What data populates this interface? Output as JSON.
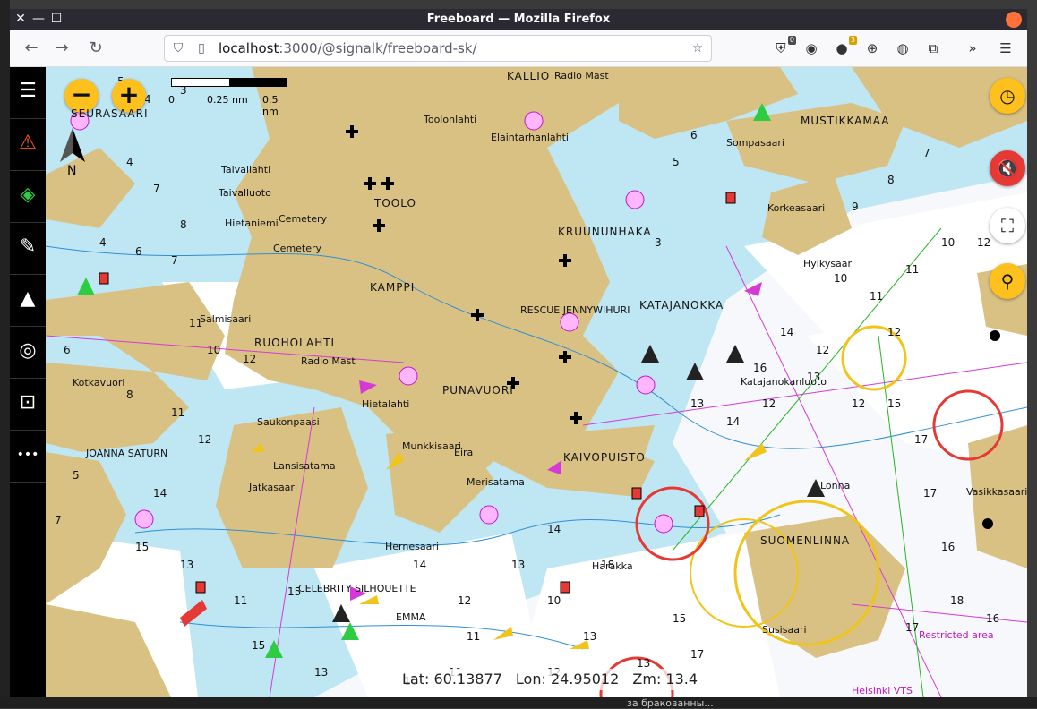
{
  "browser": {
    "title": "Freeboard — Mozilla Firefox",
    "url_host": "localhost",
    "url_rest": ":3000/@signalk/freeboard-sk/",
    "extensions": [
      {
        "icon": "ublock-icon",
        "badge": "0",
        "badge_color": "#4a4a4f"
      },
      {
        "icon": "monkey-icon",
        "badge": "",
        "badge_color": ""
      },
      {
        "icon": "coin-icon",
        "badge": "3",
        "badge_color": "#d8a000"
      },
      {
        "icon": "globe-icon",
        "badge": "",
        "badge_color": ""
      },
      {
        "icon": "cookie-icon",
        "badge": "",
        "badge_color": ""
      },
      {
        "icon": "puzzle-icon",
        "badge": "",
        "badge_color": ""
      }
    ]
  },
  "map": {
    "scale_zero": "0",
    "scale_mid": "0.25 nm",
    "scale_max": "0.5 nm",
    "labels": {
      "kallio": "KALLIO",
      "radio_mast_top": "Radio Mast",
      "toolonlahti": "Toolonlahti",
      "elaintarhanlahti": "Elaintarhanlahti",
      "toolo": "TOOLO",
      "seurasaari": "SEURASAARI",
      "taivallahti": "Taivallahti",
      "taivalluoto": "Taivalluoto",
      "hietaniemi": "Hietaniemi",
      "cemetery1": "Cemetery",
      "cemetery2": "Cemetery",
      "kamppi": "KAMPPI",
      "kruununhaka": "KRUUNUNHAKA",
      "katajanokka": "KATAJANOKKA",
      "salmisaari": "Salmisaari",
      "ruoholahti": "RUOHOLAHTI",
      "radio_mast": "Radio Mast",
      "punavuori": "PUNAVUORI",
      "kotkavuori": "Kotkavuori",
      "hietalahti": "Hietalahti",
      "saukonpaasi": "Saukonpaasi",
      "munkkisaari": "Munkkisaari",
      "eira": "Eira",
      "kaivopuisto": "KAIVOPUISTO",
      "lansisatama": "Lansisatama",
      "jatkasaari": "Jatkasaari",
      "hernesaari": "Hernesaari",
      "merisatama": "Merisatama",
      "harakka": "Harakka",
      "suomenlinna": "SUOMENLINNA",
      "susisaari": "Susisaari",
      "vasikkasaari": "Vasikkasaari",
      "korkeasaari": "Korkeasaari",
      "mustikkamaa": "MUSTIKKAMAA",
      "hylkysaari": "Hylkysaari",
      "sompasaari": "Sompasaari",
      "katajanokanluoto": "Katajanokanluoto",
      "lonna": "Lonna",
      "celebrity": "CELEBRITY SILHOUETTE",
      "emma": "EMMA",
      "joanna": "JOANNA SATURN",
      "rescue": "RESCUE JENNYWIHURI",
      "restricted": "Restricted area",
      "helsinki_vts": "Helsinki VTS"
    }
  },
  "sidebar": {
    "items": [
      {
        "name": "menu-icon",
        "glyph": "☰",
        "color": "#ffffff"
      },
      {
        "name": "alarm-icon",
        "glyph": "⚠",
        "color": "#ff5722"
      },
      {
        "name": "layers-icon",
        "glyph": "◈",
        "color": "#2ecc40"
      },
      {
        "name": "edit-icon",
        "glyph": "✎",
        "color": "#ffffff"
      },
      {
        "name": "navigate-icon",
        "glyph": "▲",
        "color": "#ffffff"
      },
      {
        "name": "gps-locate-icon",
        "glyph": "◎",
        "color": "#ffffff"
      },
      {
        "name": "center-focus-icon",
        "glyph": "⊡",
        "color": "#ffffff"
      },
      {
        "name": "more-icon",
        "glyph": "•••",
        "color": "#ffffff"
      }
    ]
  },
  "controls": {
    "zoom_out": "−",
    "zoom_in": "+",
    "right": [
      {
        "name": "anchor-watch-icon",
        "glyph": "◷",
        "bg": "#fdc01c",
        "color": "#111111"
      },
      {
        "name": "mute-icon",
        "glyph": "🔇",
        "bg": "#e53935",
        "color": "#ffffff"
      },
      {
        "name": "fullscreen-icon",
        "glyph": "⛶",
        "bg": "#ffffff",
        "color": "#111111"
      },
      {
        "name": "waypoint-icon",
        "glyph": "⚲",
        "bg": "#fdc01c",
        "color": "#111111"
      }
    ]
  },
  "status": {
    "lat": "Lat: 60.13877",
    "lon": "Lon: 24.95012",
    "zoom": "Zm: 13.4"
  },
  "desktop": {
    "bottom_text": "за бракованны..."
  }
}
